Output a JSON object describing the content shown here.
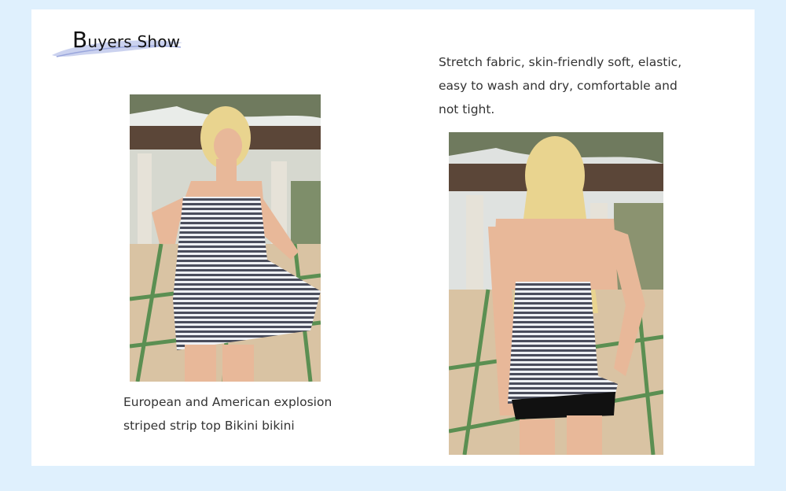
{
  "header": {
    "title_first_letter": "B",
    "title_rest": "uyers Show"
  },
  "captions": {
    "left": {
      "lines": [
        "European and American explosion",
        "striped strip top Bikini bikini"
      ]
    },
    "right": {
      "lines": [
        "Stretch fabric, skin-friendly soft, elastic,",
        "easy to wash and dry, comfortable and",
        "not tight."
      ]
    }
  },
  "colors": {
    "page_background": "#dff0fd",
    "panel_background": "#ffffff",
    "swoosh": "#b9c3ea",
    "text": "#333333"
  },
  "icons": {
    "title_decoration": "swoosh-underline"
  }
}
